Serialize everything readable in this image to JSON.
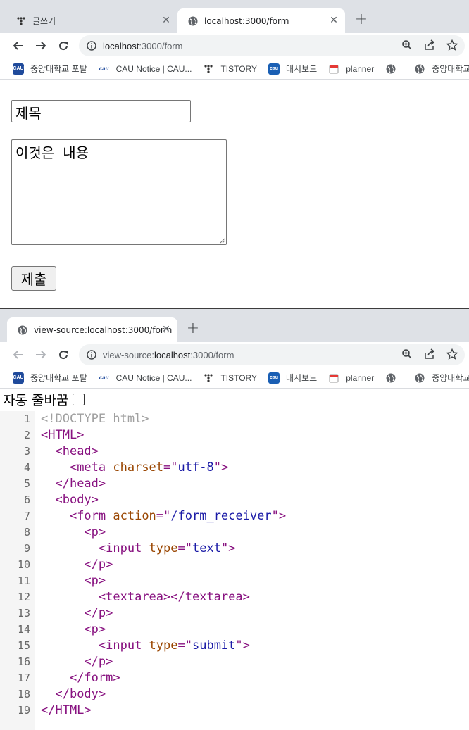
{
  "window1": {
    "tabs": [
      {
        "title": "글쓰기"
      },
      {
        "title": "localhost:3000/form"
      }
    ],
    "url_host": "localhost",
    "url_rest": ":3000/form",
    "bookmarks": [
      {
        "label": "중앙대학교 포탈",
        "icon": "cau-logo-icon"
      },
      {
        "label": "CAU Notice | CAU...",
        "icon": "cau-notice-icon"
      },
      {
        "label": "TISTORY",
        "icon": "tistory-icon"
      },
      {
        "label": "대시보드",
        "icon": "dashboard-icon"
      },
      {
        "label": "planner",
        "icon": "calendar-icon"
      },
      {
        "label": "",
        "icon": "globe-icon"
      },
      {
        "label": "중앙대학교",
        "icon": "globe-icon"
      }
    ],
    "form": {
      "text_value": "제목",
      "textarea_value": "이것은 내용",
      "submit_label": "제출"
    }
  },
  "window2": {
    "tabs": [
      {
        "title": "view-source:localhost:3000/form"
      }
    ],
    "url_prefix": "view-source:",
    "url_host": "localhost",
    "url_rest": ":3000/form",
    "bookmarks": [
      {
        "label": "중앙대학교 포탈",
        "icon": "cau-logo-icon"
      },
      {
        "label": "CAU Notice | CAU...",
        "icon": "cau-notice-icon"
      },
      {
        "label": "TISTORY",
        "icon": "tistory-icon"
      },
      {
        "label": "대시보드",
        "icon": "dashboard-icon"
      },
      {
        "label": "planner",
        "icon": "calendar-icon"
      },
      {
        "label": "",
        "icon": "globe-icon"
      },
      {
        "label": "중앙대학교",
        "icon": "globe-icon"
      }
    ],
    "wrap_label": "자동 줄바꿈",
    "source_lines": [
      {
        "n": "1",
        "indent": "",
        "parts": [
          [
            "doc",
            "<!DOCTYPE html>"
          ]
        ]
      },
      {
        "n": "2",
        "indent": "",
        "parts": [
          [
            "tag",
            "<HTML>"
          ]
        ]
      },
      {
        "n": "3",
        "indent": "  ",
        "parts": [
          [
            "tag",
            "<head>"
          ]
        ]
      },
      {
        "n": "4",
        "indent": "    ",
        "parts": [
          [
            "tag",
            "<meta "
          ],
          [
            "attr",
            "charset"
          ],
          [
            "tag",
            "=\""
          ],
          [
            "val",
            "utf-8"
          ],
          [
            "tag",
            "\">"
          ]
        ]
      },
      {
        "n": "5",
        "indent": "  ",
        "parts": [
          [
            "tag",
            "</head>"
          ]
        ]
      },
      {
        "n": "6",
        "indent": "  ",
        "parts": [
          [
            "tag",
            "<body>"
          ]
        ]
      },
      {
        "n": "7",
        "indent": "    ",
        "parts": [
          [
            "tag",
            "<form "
          ],
          [
            "attr",
            "action"
          ],
          [
            "tag",
            "=\""
          ],
          [
            "val",
            "/form_receiver"
          ],
          [
            "tag",
            "\">"
          ]
        ]
      },
      {
        "n": "8",
        "indent": "      ",
        "parts": [
          [
            "tag",
            "<p>"
          ]
        ]
      },
      {
        "n": "9",
        "indent": "        ",
        "parts": [
          [
            "tag",
            "<input "
          ],
          [
            "attr",
            "type"
          ],
          [
            "tag",
            "=\""
          ],
          [
            "val",
            "text"
          ],
          [
            "tag",
            "\">"
          ]
        ]
      },
      {
        "n": "10",
        "indent": "      ",
        "parts": [
          [
            "tag",
            "</p>"
          ]
        ]
      },
      {
        "n": "11",
        "indent": "      ",
        "parts": [
          [
            "tag",
            "<p>"
          ]
        ]
      },
      {
        "n": "12",
        "indent": "        ",
        "parts": [
          [
            "tag",
            "<textarea></textarea>"
          ]
        ]
      },
      {
        "n": "13",
        "indent": "      ",
        "parts": [
          [
            "tag",
            "</p>"
          ]
        ]
      },
      {
        "n": "14",
        "indent": "      ",
        "parts": [
          [
            "tag",
            "<p>"
          ]
        ]
      },
      {
        "n": "15",
        "indent": "        ",
        "parts": [
          [
            "tag",
            "<input "
          ],
          [
            "attr",
            "type"
          ],
          [
            "tag",
            "=\""
          ],
          [
            "val",
            "submit"
          ],
          [
            "tag",
            "\">"
          ]
        ]
      },
      {
        "n": "16",
        "indent": "      ",
        "parts": [
          [
            "tag",
            "</p>"
          ]
        ]
      },
      {
        "n": "17",
        "indent": "    ",
        "parts": [
          [
            "tag",
            "</form>"
          ]
        ]
      },
      {
        "n": "18",
        "indent": "  ",
        "parts": [
          [
            "tag",
            "</body>"
          ]
        ]
      },
      {
        "n": "19",
        "indent": "",
        "parts": [
          [
            "tag",
            "</HTML>"
          ]
        ]
      }
    ]
  },
  "colors": {
    "tag": "#881280",
    "attr": "#994500",
    "value": "#1a1aa6",
    "doctype": "#a0a0a0",
    "tabstrip": "#dee1e6"
  }
}
